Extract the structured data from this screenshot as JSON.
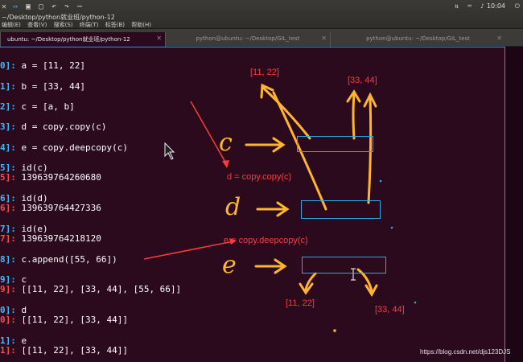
{
  "window": {
    "title": "~/Desktop/python就业班/python-12",
    "menu": [
      "编辑(E)",
      "查看(V)",
      "搜索(S)",
      "终端(T)",
      "标签(B)",
      "帮助(H)"
    ],
    "clock": "10:04"
  },
  "tabs": [
    {
      "label": "ubuntu: ~/Desktop/python就业班/python-12",
      "active": true
    },
    {
      "label": "python@ubuntu: ~/Desktop/GIL_test",
      "active": false
    },
    {
      "label": "python@ubuntu: ~/Desktop/GIL_test",
      "active": false
    }
  ],
  "terminal": {
    "lines": [
      {
        "prompt": "0]:",
        "type": "in",
        "text": " a = [11, 22]"
      },
      {
        "prompt": "1]:",
        "type": "in",
        "text": " b = [33, 44]"
      },
      {
        "prompt": "2]:",
        "type": "in",
        "text": " c = [a, b]"
      },
      {
        "prompt": "3]:",
        "type": "in",
        "text": " d = copy.copy(c)"
      },
      {
        "prompt": "4]:",
        "type": "in",
        "text": " e = copy.deepcopy(c)"
      },
      {
        "prompt": "5]:",
        "type": "in",
        "text": " id(c)"
      },
      {
        "prompt": "5]:",
        "type": "out",
        "text": " 139639764260680"
      },
      {
        "prompt": "6]:",
        "type": "in",
        "text": " id(d)"
      },
      {
        "prompt": "6]:",
        "type": "out",
        "text": " 139639764427336"
      },
      {
        "prompt": "7]:",
        "type": "in",
        "text": " id(e)"
      },
      {
        "prompt": "7]:",
        "type": "out",
        "text": " 139639764218120"
      },
      {
        "prompt": "8]:",
        "type": "in",
        "text": " c.append([55, 66])"
      },
      {
        "prompt": "9]:",
        "type": "in",
        "text": " c"
      },
      {
        "prompt": "9]:",
        "type": "out",
        "text": " [[11, 22], [33, 44], [55, 66]]"
      },
      {
        "prompt": "0]:",
        "type": "in",
        "text": " d"
      },
      {
        "prompt": "0]:",
        "type": "out",
        "text": " [[11, 22], [33, 44]]"
      },
      {
        "prompt": "1]:",
        "type": "in",
        "text": " e"
      },
      {
        "prompt": "1]:",
        "type": "out",
        "text": " [[11, 22], [33, 44]]"
      }
    ]
  },
  "annotations": {
    "label_list_a_top": "[11, 22]",
    "label_list_b_top": "[33, 44]",
    "label_shallow": "d = copy.copy(c)",
    "label_deep": "e = copy.deepcopy(c)",
    "label_list_a_bottom": "[11, 22]",
    "label_list_b_bottom": "[33, 44]",
    "hand_c": "c",
    "hand_d": "d",
    "hand_e": "e",
    "colors": {
      "annotation_red": "#ff3b3b",
      "handwriting_orange": "#ffb52e",
      "box_blue": "#2fa9e6"
    }
  },
  "watermark": "https://blog.csdn.net/djs123DJS"
}
